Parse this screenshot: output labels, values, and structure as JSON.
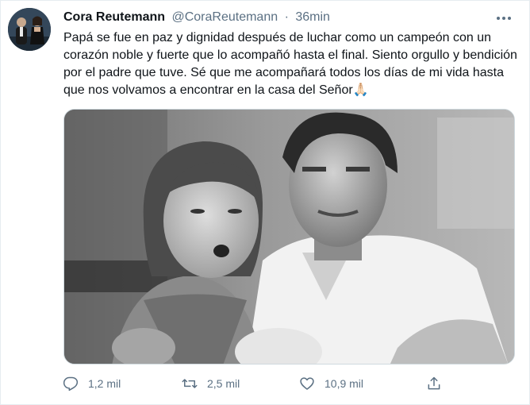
{
  "user": {
    "display_name": "Cora Reutemann",
    "handle": "@CoraReutemann",
    "time_separator": "·",
    "time": "36min"
  },
  "tweet": {
    "text": "Papá se fue en paz y dignidad después de luchar como un campeón con un corazón noble y fuerte que lo acompañó hasta el final. Siento orgullo y bendición por el padre que tuve. Sé que me acompañará todos los días de mi vida hasta que nos volvamos a encontrar en la casa del Señor",
    "emoji": "🙏🏻"
  },
  "actions": {
    "reply_count": "1,2 mil",
    "retweet_count": "2,5 mil",
    "like_count": "10,9 mil"
  },
  "icons": {
    "more": "more-dots-icon",
    "reply": "reply-icon",
    "retweet": "retweet-icon",
    "like": "heart-icon",
    "share": "share-icon"
  },
  "colors": {
    "text": "#0f1419",
    "secondary": "#5b7083",
    "border": "#e6ecf0"
  }
}
